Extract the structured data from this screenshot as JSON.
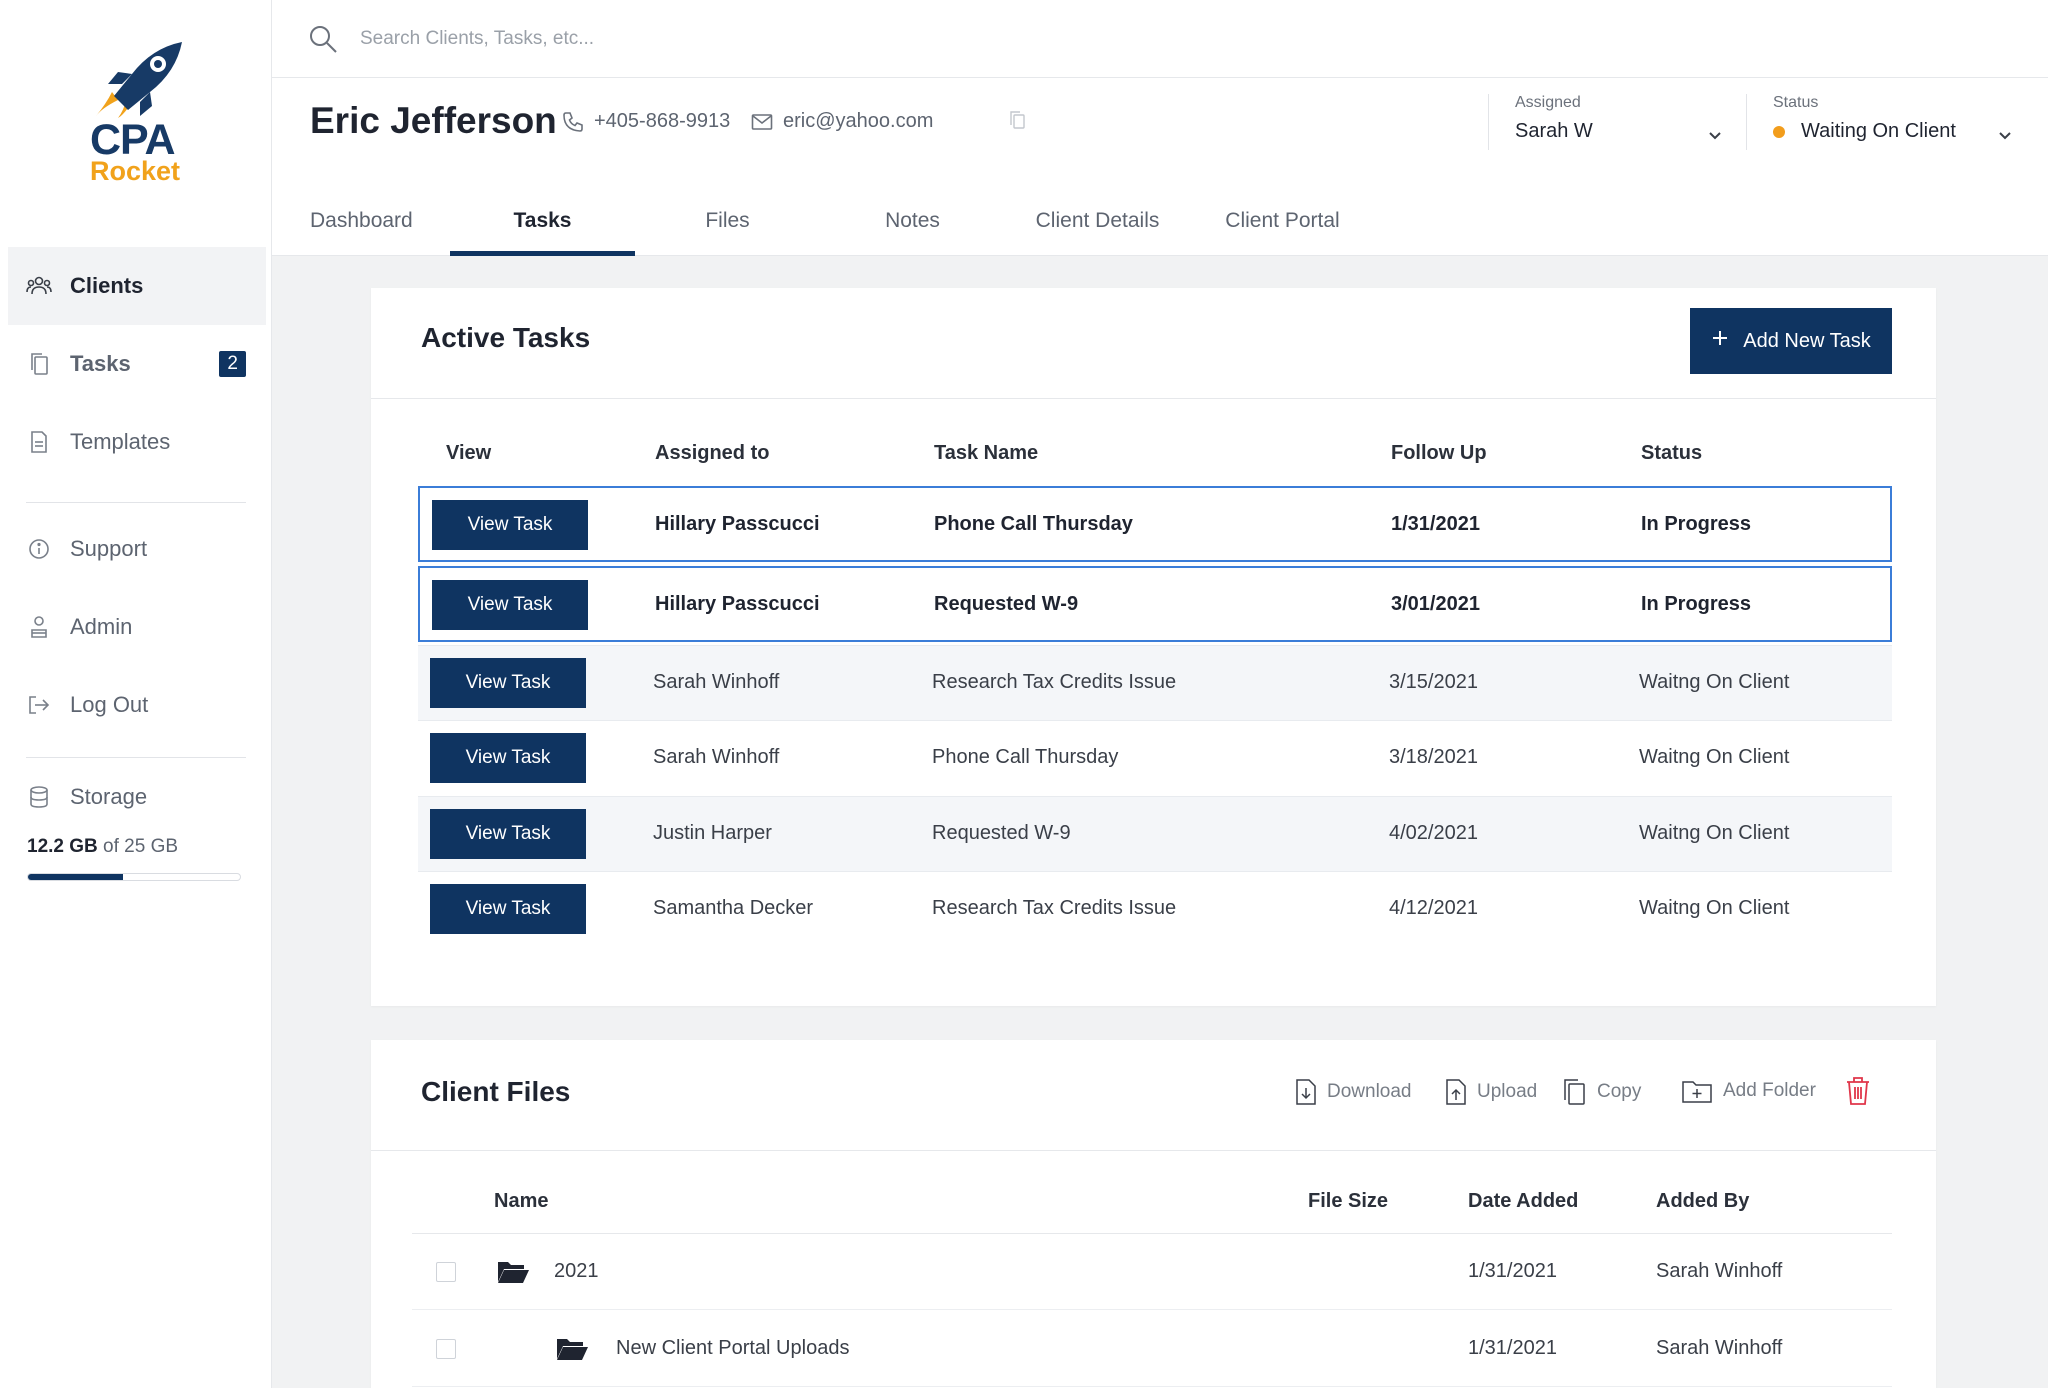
{
  "brand": {
    "line1": "CPA",
    "line2": "Rocket",
    "primary_color": "#173a66",
    "accent_color": "#f1a21b"
  },
  "sidebar": {
    "items": [
      {
        "label": "Clients",
        "icon": "users-icon"
      },
      {
        "label": "Tasks",
        "icon": "documents-icon",
        "badge": "2"
      },
      {
        "label": "Templates",
        "icon": "template-icon"
      },
      {
        "label": "Support",
        "icon": "info-icon"
      },
      {
        "label": "Admin",
        "icon": "admin-icon"
      },
      {
        "label": "Log Out",
        "icon": "logout-icon"
      },
      {
        "label": "Storage",
        "icon": "database-icon"
      }
    ],
    "storage": {
      "used": "12.2 GB",
      "total_text": "of 25 GB",
      "fraction_used": 0.45
    }
  },
  "search": {
    "placeholder": "Search Clients, Tasks, etc..."
  },
  "client": {
    "name": "Eric Jefferson",
    "phone": "+405-868-9913",
    "email": "eric@yahoo.com",
    "assigned_label": "Assigned",
    "assigned_value": "Sarah W",
    "status_label": "Status",
    "status_value": "Waiting On Client",
    "status_color": "#f29d1c"
  },
  "tabs": [
    "Dashboard",
    "Tasks",
    "Files",
    "Notes",
    "Client Details",
    "Client Portal"
  ],
  "active_tab": "Tasks",
  "active_tasks": {
    "title": "Active Tasks",
    "add_button": "Add New Task",
    "columns": [
      "View",
      "Assigned to",
      "Task Name",
      "Follow Up",
      "Status"
    ],
    "view_button": "View Task",
    "rows": [
      {
        "assigned": "Hillary Passcucci",
        "task": "Phone Call Thursday",
        "follow_up": "1/31/2021",
        "status": "In Progress"
      },
      {
        "assigned": "Hillary Passcucci",
        "task": "Requested W-9",
        "follow_up": "3/01/2021",
        "status": "In Progress"
      },
      {
        "assigned": "Sarah Winhoff",
        "task": "Research Tax Credits Issue",
        "follow_up": "3/15/2021",
        "status": "Waitng On Client"
      },
      {
        "assigned": "Sarah Winhoff",
        "task": "Phone Call Thursday",
        "follow_up": "3/18/2021",
        "status": "Waitng On Client"
      },
      {
        "assigned": "Justin Harper",
        "task": "Requested W-9",
        "follow_up": "4/02/2021",
        "status": "Waitng On Client"
      },
      {
        "assigned": "Samantha Decker",
        "task": "Research Tax Credits Issue",
        "follow_up": "4/12/2021",
        "status": "Waitng On Client"
      }
    ]
  },
  "client_files": {
    "title": "Client Files",
    "tools": [
      "Download",
      "Upload",
      "Copy",
      "Add Folder"
    ],
    "columns": [
      "Name",
      "File Size",
      "Date Added",
      "Added By"
    ],
    "rows": [
      {
        "name": "2021",
        "size": "",
        "date": "1/31/2021",
        "added_by": "Sarah Winhoff"
      },
      {
        "name": "New Client Portal Uploads",
        "size": "",
        "date": "1/31/2021",
        "added_by": "Sarah Winhoff"
      }
    ]
  }
}
